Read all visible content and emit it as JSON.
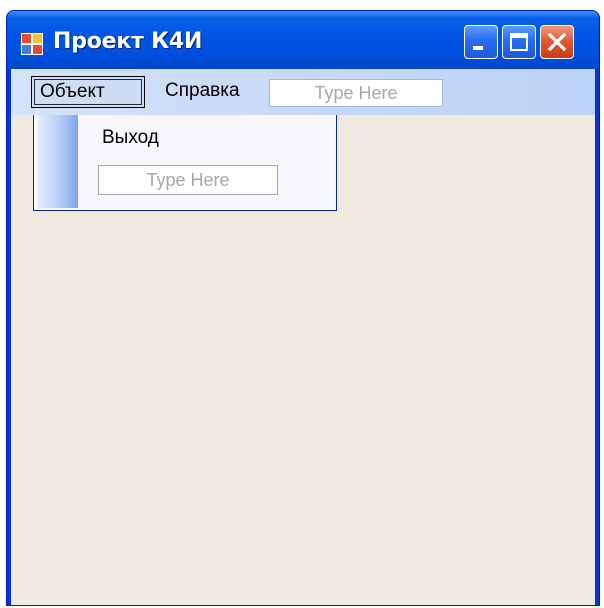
{
  "window": {
    "title": "Проект К4И",
    "icon": "app-window-icon",
    "controls": [
      "minimize-icon",
      "maximize-icon",
      "close-icon"
    ]
  },
  "menubar": {
    "items": [
      {
        "label": "Объект",
        "open": true
      },
      {
        "label": "Справка"
      }
    ],
    "type_here": "Type Here"
  },
  "dropdown": {
    "items": [
      {
        "label": "Выход"
      }
    ],
    "type_here": "Type Here"
  },
  "colors": {
    "title_bar": "#0055e5",
    "client_background": "#efe9df",
    "menubar": "#c5d8f7",
    "close_button": "#e15c35"
  }
}
